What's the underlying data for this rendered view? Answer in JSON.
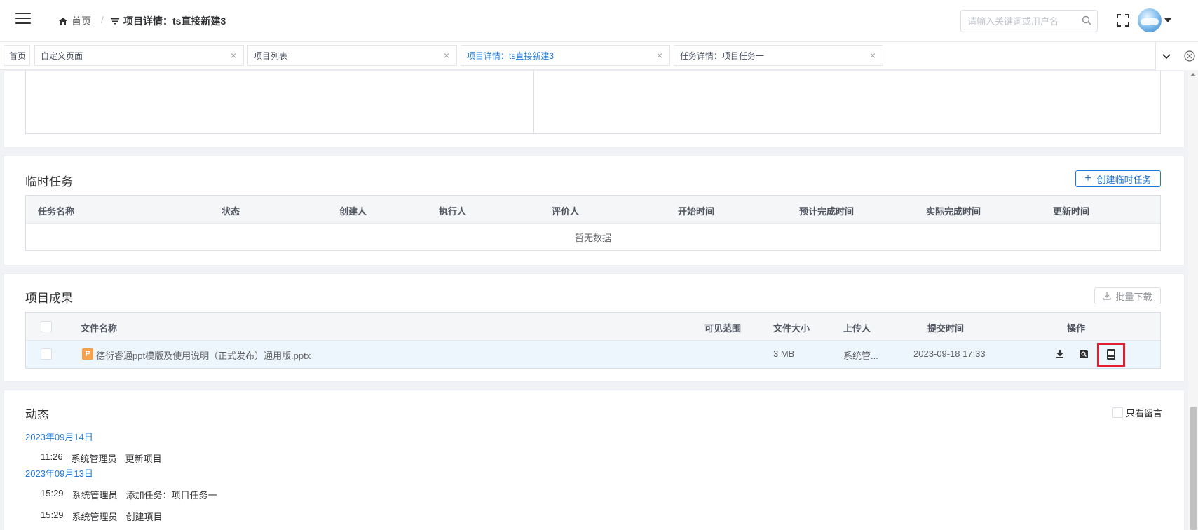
{
  "header": {
    "breadcrumb_home": "首页",
    "breadcrumb_sep": "/",
    "breadcrumb_current": "项目详情：ts直接新建3",
    "search_placeholder": "请输入关键词或用户名"
  },
  "tabs": [
    {
      "label": "首页"
    },
    {
      "label": "自定义页面"
    },
    {
      "label": "项目列表"
    },
    {
      "label": "项目详情：ts直接新建3",
      "active": true
    },
    {
      "label": "任务详情：项目任务一"
    }
  ],
  "temp_tasks": {
    "title": "临时任务",
    "create_button": "创建临时任务",
    "columns": [
      "任务名称",
      "状态",
      "创建人",
      "执行人",
      "评价人",
      "开始时间",
      "预计完成时间",
      "实际完成时间",
      "更新时间"
    ],
    "empty_text": "暂无数据"
  },
  "results": {
    "title": "项目成果",
    "batch_button": "批量下载",
    "columns": {
      "name": "文件名称",
      "scope": "可见范围",
      "size": "文件大小",
      "uploader": "上传人",
      "time": "提交时间",
      "ops": "操作"
    },
    "rows": [
      {
        "file_type": "P",
        "name": "德衍睿通ppt模版及使用说明（正式发布）通用版.pptx",
        "scope": "",
        "size": "3 MB",
        "uploader": "系统管...",
        "time": "2023-09-18 17:33"
      }
    ]
  },
  "activity": {
    "title": "动态",
    "only_messages": "只看留言",
    "groups": [
      {
        "date": "2023年09月14日",
        "items": [
          {
            "time": "11:26",
            "user": "系统管理员",
            "action": "更新项目"
          }
        ]
      },
      {
        "date": "2023年09月13日",
        "items": [
          {
            "time": "15:29",
            "user": "系统管理员",
            "action": "添加任务：项目任务一"
          },
          {
            "time": "15:29",
            "user": "系统管理员",
            "action": "创建项目"
          }
        ]
      }
    ]
  },
  "colors": {
    "accent": "#1f78d6",
    "highlight": "#e01e2f",
    "file_ppt": "#f5a04a"
  },
  "icons": [
    "menu-icon",
    "home-icon",
    "filter-icon",
    "search-icon",
    "fullscreen-icon",
    "caret-down-icon",
    "close-icon",
    "chevron-down-icon",
    "circle-close-icon",
    "download-icon",
    "preview-icon",
    "archive-icon"
  ]
}
